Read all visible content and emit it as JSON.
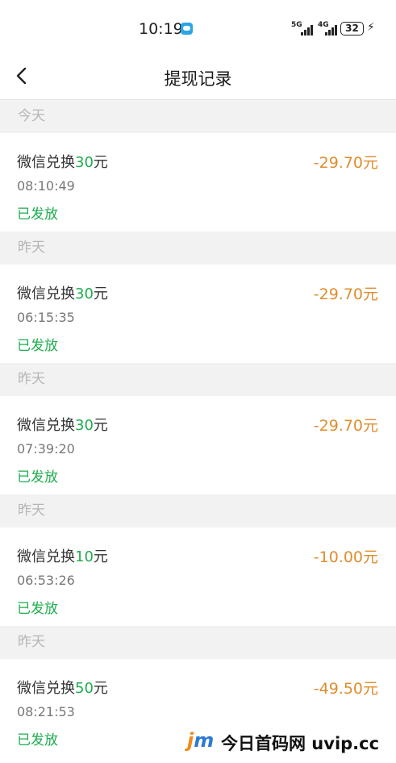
{
  "status_bar": {
    "time": "10:19",
    "signal1": "5G",
    "signal2": "4G",
    "battery": "32"
  },
  "header": {
    "title": "提现记录"
  },
  "sections": [
    {
      "date": "今天",
      "record": {
        "prefix": "微信兑换",
        "num": "30",
        "suffix": "元",
        "time": "08:10:49",
        "status": "已发放",
        "amount": "-29.70元"
      }
    },
    {
      "date": "昨天",
      "record": {
        "prefix": "微信兑换",
        "num": "30",
        "suffix": "元",
        "time": "06:15:35",
        "status": "已发放",
        "amount": "-29.70元"
      }
    },
    {
      "date": "昨天",
      "record": {
        "prefix": "微信兑换",
        "num": "30",
        "suffix": "元",
        "time": "07:39:20",
        "status": "已发放",
        "amount": "-29.70元"
      }
    },
    {
      "date": "昨天",
      "record": {
        "prefix": "微信兑换",
        "num": "10",
        "suffix": "元",
        "time": "06:53:26",
        "status": "已发放",
        "amount": "-10.00元"
      }
    },
    {
      "date": "昨天",
      "record": {
        "prefix": "微信兑换",
        "num": "50",
        "suffix": "元",
        "time": "08:21:53",
        "status": "已发放",
        "amount": "-49.50元"
      }
    }
  ],
  "watermark": {
    "logo_j": "j",
    "logo_m": "m",
    "text": "今日首码网 uvip.cc"
  },
  "colors": {
    "green": "#1fad4e",
    "amount_orange": "#e08d2c",
    "section_bg": "#f2f2f2"
  }
}
